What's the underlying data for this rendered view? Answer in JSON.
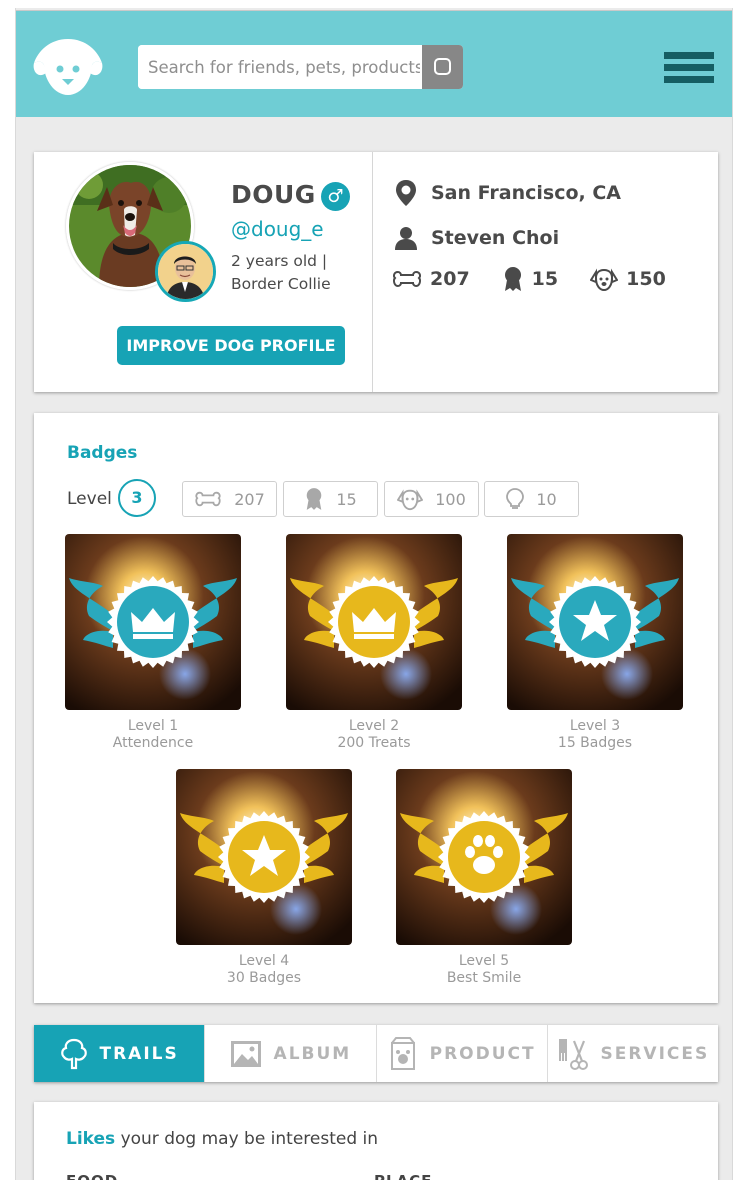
{
  "header": {
    "search_placeholder": "Search for friends, pets, products"
  },
  "profile": {
    "dog_name": "DOUG",
    "gender_symbol": "♂",
    "handle": "@doug_e",
    "age": "2 years old |",
    "breed": "Border Collie",
    "improve_button": "IMPROVE DOG PROFILE",
    "location": "San Francisco, CA",
    "owner_name": "Steven Choi",
    "stats": {
      "treats": "207",
      "badges": "15",
      "friends": "150"
    }
  },
  "badges": {
    "title": "Badges",
    "level_label": "Level",
    "level": "3",
    "counters": [
      {
        "icon": "bone-icon",
        "value": "207"
      },
      {
        "icon": "ribbon-icon",
        "value": "15"
      },
      {
        "icon": "dog-face-icon",
        "value": "100"
      },
      {
        "icon": "lightbulb-icon",
        "value": "10"
      }
    ],
    "items": [
      {
        "level": "Level 1",
        "name": "Attendence",
        "color": "#2aa9bd",
        "symbol": "crown"
      },
      {
        "level": "Level 2",
        "name": "200 Treats",
        "color": "#e7b81c",
        "symbol": "crown"
      },
      {
        "level": "Level 3",
        "name": "15 Badges",
        "color": "#2aa9bd",
        "symbol": "star"
      },
      {
        "level": "Level 4",
        "name": "30 Badges",
        "color": "#e7b81c",
        "symbol": "star"
      },
      {
        "level": "Level 5",
        "name": "Best Smile",
        "color": "#e7b81c",
        "symbol": "paw"
      }
    ]
  },
  "tabs": [
    {
      "label": "TRAILS",
      "icon": "tree-icon",
      "active": true
    },
    {
      "label": "ALBUM",
      "icon": "image-icon",
      "active": false
    },
    {
      "label": "PRODUCT",
      "icon": "dog-food-icon",
      "active": false
    },
    {
      "label": "SERVICES",
      "icon": "grooming-icon",
      "active": false
    }
  ],
  "likes": {
    "title_bold": "Likes",
    "title_rest": " your dog may be interested in",
    "col_food": "FOOD",
    "col_place": "PLACE"
  },
  "colors": {
    "header_bg": "#6fcdd4",
    "accent": "#17a3b5",
    "menu": "#155e63"
  }
}
